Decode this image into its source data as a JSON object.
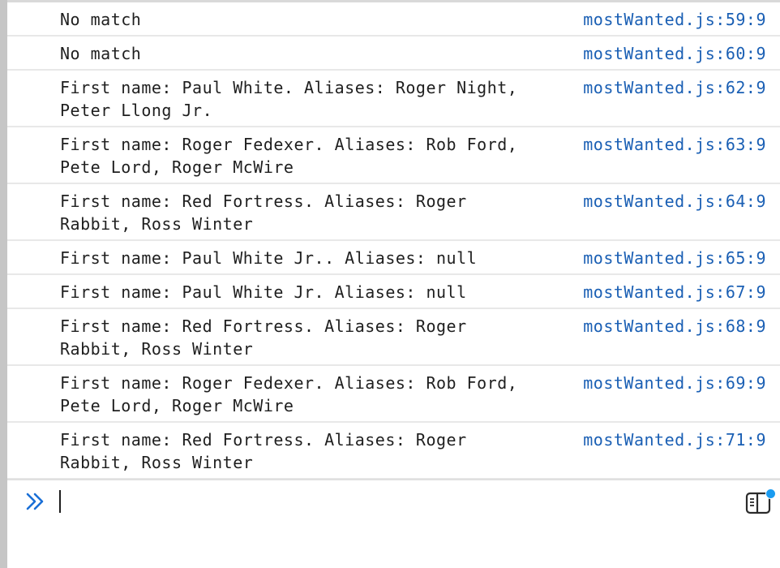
{
  "console": {
    "messages": [
      {
        "text": "No match",
        "source": "mostWanted.js:59:9"
      },
      {
        "text": "No match",
        "source": "mostWanted.js:60:9"
      },
      {
        "text": "First name: Paul White. Aliases: Roger Night,\nPeter Llong Jr.",
        "source": "mostWanted.js:62:9"
      },
      {
        "text": "First name: Roger Fedexer. Aliases: Rob Ford,\nPete Lord, Roger McWire",
        "source": "mostWanted.js:63:9"
      },
      {
        "text": "First name: Red Fortress. Aliases: Roger\nRabbit, Ross Winter",
        "source": "mostWanted.js:64:9"
      },
      {
        "text": "First name: Paul White Jr.. Aliases: null",
        "source": "mostWanted.js:65:9"
      },
      {
        "text": "First name: Paul White Jr. Aliases: null",
        "source": "mostWanted.js:67:9"
      },
      {
        "text": "First name: Red Fortress. Aliases: Roger\nRabbit, Ross Winter",
        "source": "mostWanted.js:68:9"
      },
      {
        "text": "First name: Roger Fedexer. Aliases: Rob Ford,\nPete Lord, Roger McWire",
        "source": "mostWanted.js:69:9"
      },
      {
        "text": "First name: Red Fortress. Aliases: Roger\nRabbit, Ross Winter",
        "source": "mostWanted.js:71:9"
      }
    ],
    "prompt": {
      "icon": "chevron-double-right-icon",
      "value": ""
    },
    "sidebar_toggle_icon": "sidebar-panel-icon",
    "colors": {
      "link": "#1a5fb4",
      "prompt_icon": "#1a6fd6",
      "badge": "#1a9bf0"
    }
  }
}
